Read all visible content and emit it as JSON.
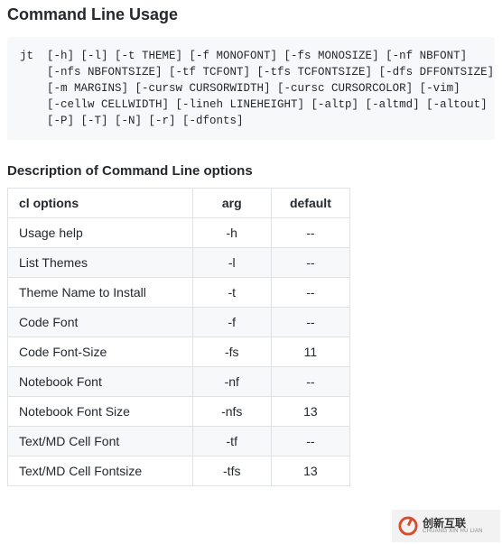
{
  "heading": "Command Line Usage",
  "code": "jt  [-h] [-l] [-t THEME] [-f MONOFONT] [-fs MONOSIZE] [-nf NBFONT]\n    [-nfs NBFONTSIZE] [-tf TCFONT] [-tfs TCFONTSIZE] [-dfs DFFONTSIZE]\n    [-m MARGINS] [-cursw CURSORWIDTH] [-cursc CURSORCOLOR] [-vim]\n    [-cellw CELLWIDTH] [-lineh LINEHEIGHT] [-altp] [-altmd] [-altout]\n    [-P] [-T] [-N] [-r] [-dfonts]",
  "subheading": "Description of Command Line options",
  "table": {
    "headers": [
      "cl options",
      "arg",
      "default"
    ],
    "rows": [
      {
        "opt": "Usage help",
        "arg": "-h",
        "def": "--"
      },
      {
        "opt": "List Themes",
        "arg": "-l",
        "def": "--"
      },
      {
        "opt": "Theme Name to Install",
        "arg": "-t",
        "def": "--"
      },
      {
        "opt": "Code Font",
        "arg": "-f",
        "def": "--"
      },
      {
        "opt": "Code Font-Size",
        "arg": "-fs",
        "def": "11"
      },
      {
        "opt": "Notebook Font",
        "arg": "-nf",
        "def": "--"
      },
      {
        "opt": "Notebook Font Size",
        "arg": "-nfs",
        "def": "13"
      },
      {
        "opt": "Text/MD Cell Font",
        "arg": "-tf",
        "def": "--"
      },
      {
        "opt": "Text/MD Cell Fontsize",
        "arg": "-tfs",
        "def": "13"
      }
    ]
  },
  "logo": {
    "cn": "创新互联",
    "en": "CHUANG XIN HU LIAN"
  }
}
